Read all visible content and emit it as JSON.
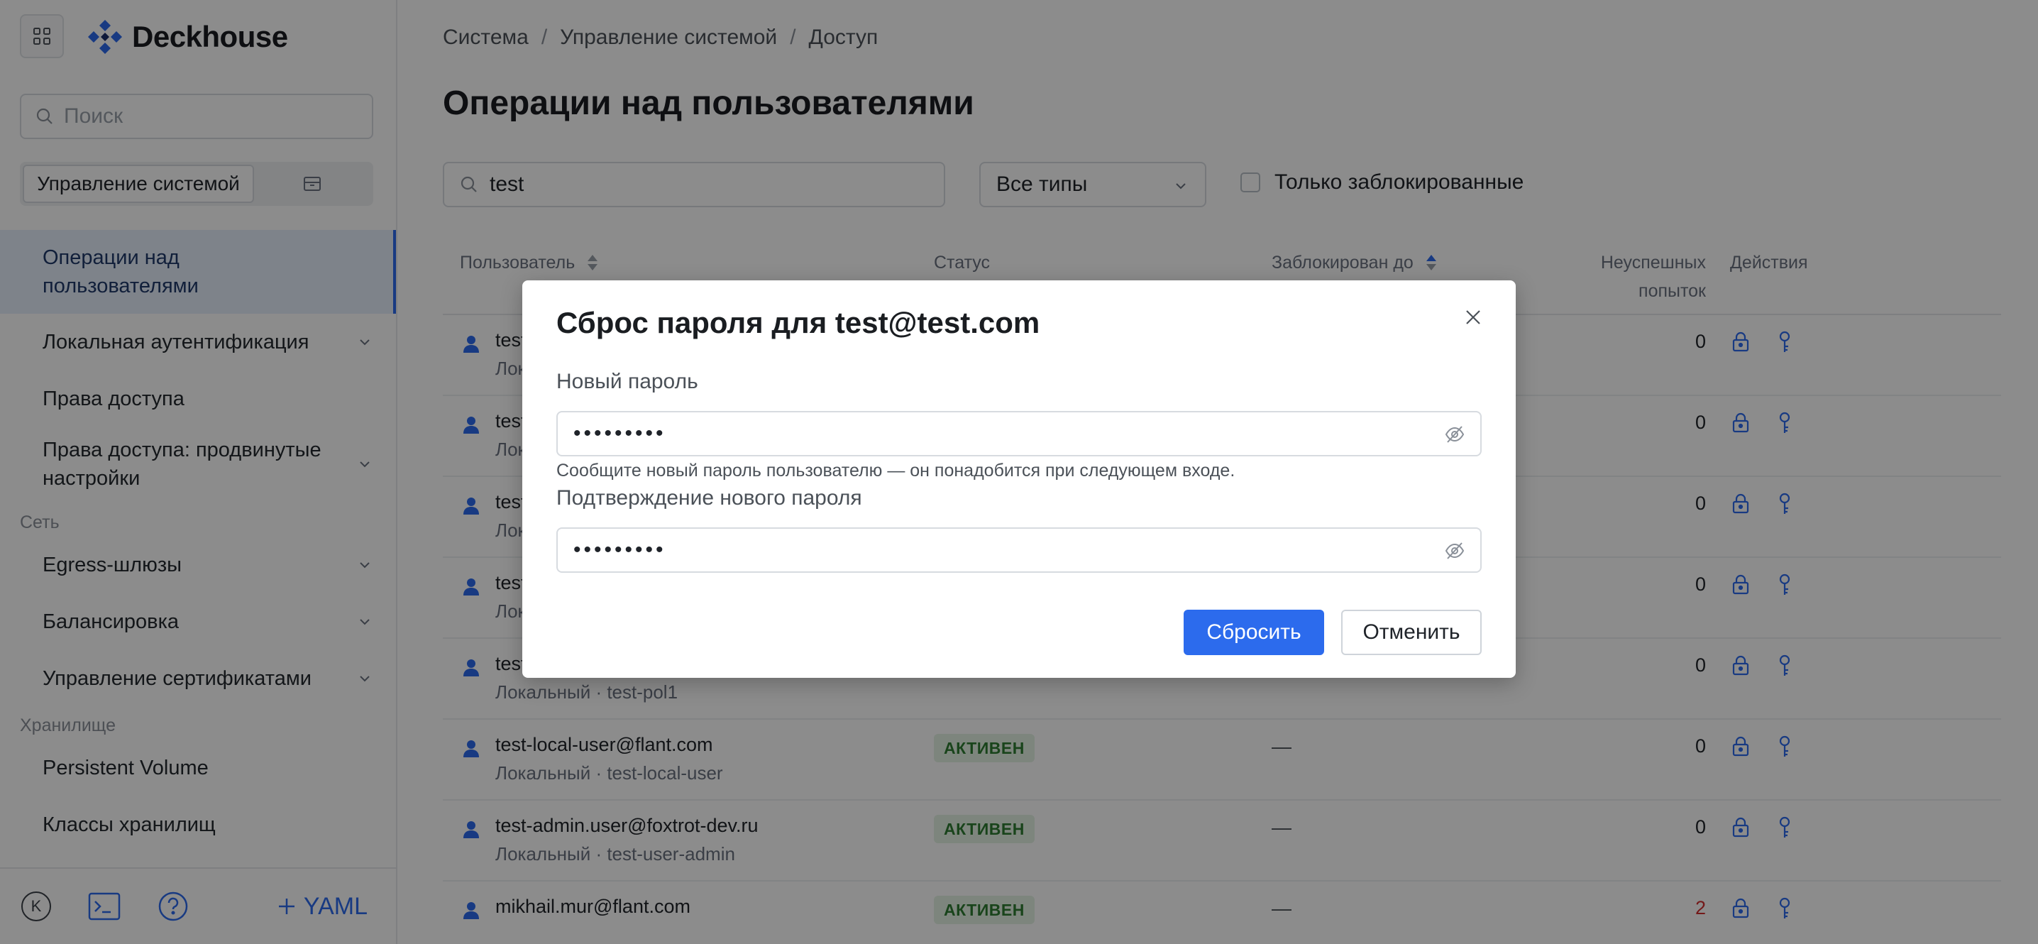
{
  "app": {
    "brand": "Deckhouse",
    "brand_color": "#2c6bed"
  },
  "sidebar": {
    "search_placeholder": "Поиск",
    "segments": [
      {
        "label": "Управление системой",
        "active": true
      },
      {
        "label": "",
        "icon": "archive-icon",
        "active": false
      }
    ],
    "items": [
      {
        "label": "Операции над пользователями",
        "active": true,
        "expandable": false
      },
      {
        "label": "Локальная аутентификация",
        "expandable": true
      },
      {
        "label": "Права доступа",
        "expandable": false
      },
      {
        "label": "Права доступа: продвинутые настройки",
        "expandable": true
      }
    ],
    "section_network": "Сеть",
    "network_items": [
      {
        "label": "Egress-шлюзы",
        "expandable": true
      },
      {
        "label": "Балансировка",
        "expandable": true
      },
      {
        "label": "Управление сертификатами",
        "expandable": true
      }
    ],
    "section_storage": "Хранилище",
    "storage_items": [
      {
        "label": "Persistent Volume"
      },
      {
        "label": "Классы хранилищ"
      }
    ],
    "footer": {
      "avatar_letter": "K",
      "add_yaml": "YAML"
    }
  },
  "main": {
    "breadcrumbs": [
      "Система",
      "Управление системой",
      "Доступ"
    ],
    "title": "Операции над пользователями",
    "search_value": "test",
    "type_filter": "Все типы",
    "blocked_only": "Только заблокированные",
    "columns": {
      "user": "Пользователь",
      "status": "Статус",
      "blocked_until": "Заблокирован до",
      "failed_line1": "Неуспешных",
      "failed_line2": "попыток",
      "actions": "Действия"
    },
    "rows": [
      {
        "email": "test",
        "sub": "Лок",
        "status": "",
        "blocked": "",
        "fails": "0"
      },
      {
        "email": "test",
        "sub": "Лок",
        "status": "",
        "blocked": "",
        "fails": "0"
      },
      {
        "email": "test",
        "sub": "Лок",
        "status": "",
        "blocked": "",
        "fails": "0"
      },
      {
        "email": "test",
        "sub": "Лок",
        "status": "",
        "blocked": "",
        "fails": "0"
      },
      {
        "email": "test",
        "sub": "Локальный · test-pol1",
        "status": "",
        "blocked": "",
        "fails": "0"
      },
      {
        "email": "test-local-user@flant.com",
        "sub": "Локальный · test-local-user",
        "status": "АКТИВЕН",
        "blocked": "—",
        "fails": "0"
      },
      {
        "email": "test-admin.user@foxtrot-dev.ru",
        "sub": "Локальный · test-user-admin",
        "status": "АКТИВЕН",
        "blocked": "—",
        "fails": "0"
      },
      {
        "email": "mikhail.mur@flant.com",
        "sub": "",
        "status": "АКТИВЕН",
        "blocked": "—",
        "fails": "2",
        "fails_alert": true
      }
    ]
  },
  "modal": {
    "title": "Сброс пароля для test@test.com",
    "new_password_label": "Новый пароль",
    "new_password_value": "•••••••••",
    "hint": "Сообщите новый пароль пользователю — он понадобится при следующем входе.",
    "confirm_label": "Подтверждение нового пароля",
    "confirm_value": "•••••••••",
    "submit": "Сбросить",
    "cancel": "Отменить"
  }
}
